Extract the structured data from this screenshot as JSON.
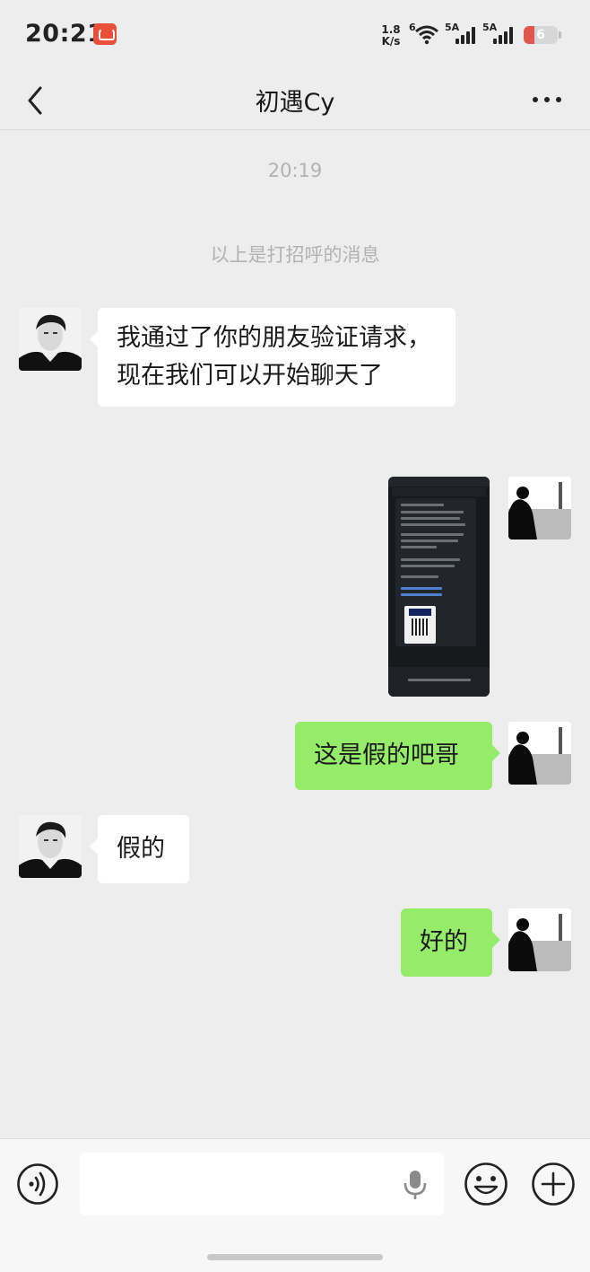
{
  "status_bar": {
    "time": "20:21",
    "net_speed_value": "1.8",
    "net_speed_unit": "K/s",
    "wifi_label": "6",
    "signal1_label": "5A",
    "signal2_label": "5A",
    "battery_level": "6",
    "battery_fraction": 0.06
  },
  "nav": {
    "title": "初遇Cy"
  },
  "chat": {
    "timestamp": "20:19",
    "system_message": "以上是打招呼的消息",
    "messages": [
      {
        "side": "in",
        "text": "我通过了你的朋友验证请求，现在我们可以开始聊天了"
      },
      {
        "side": "out",
        "type": "image",
        "image_icon": "screenshot-image"
      },
      {
        "side": "out",
        "text": "这是假的吧哥"
      },
      {
        "side": "in",
        "text": "假的"
      },
      {
        "side": "out",
        "text": "好的"
      }
    ]
  },
  "input_bar": {
    "value": "",
    "placeholder": ""
  },
  "colors": {
    "background": "#ededed",
    "incoming_bubble": "#ffffff",
    "outgoing_bubble": "#95ec69",
    "meta_text": "#b2b2b2",
    "battery_low": "#e0574f"
  }
}
